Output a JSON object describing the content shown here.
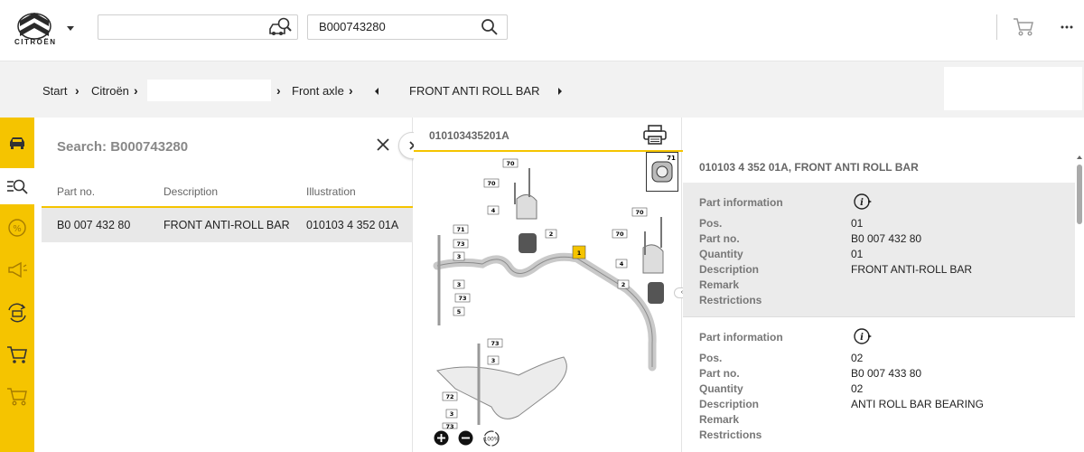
{
  "header": {
    "logo_word": "CITROËN",
    "part_search_value": "B000743280"
  },
  "breadcrumb": {
    "items": [
      "Start",
      "Citroën",
      "Front axle",
      "FRONT ANTI ROLL BAR"
    ]
  },
  "search_panel": {
    "title": "Search: B000743280",
    "columns": [
      "Part no.",
      "Description",
      "Illustration"
    ],
    "rows": [
      {
        "part_no": "B0 007 432 80",
        "description": "FRONT ANTI-ROLL BAR",
        "illustration": "010103 4 352 01A"
      }
    ]
  },
  "illustration": {
    "id": "010103435201A",
    "zoom_label": "100%",
    "thumb_label": "71",
    "callouts": [
      "70",
      "70",
      "4",
      "2",
      "1",
      "71",
      "73",
      "3",
      "3",
      "73",
      "5",
      "73",
      "3",
      "72",
      "3",
      "73",
      "70",
      "70",
      "4",
      "2",
      "71"
    ]
  },
  "detail": {
    "title": "010103 4 352 01A, FRONT ANTI ROLL BAR",
    "labels": {
      "section": "Part information",
      "pos": "Pos.",
      "part_no": "Part no.",
      "quantity": "Quantity",
      "description": "Description",
      "remark": "Remark",
      "restrictions": "Restrictions"
    },
    "blocks": [
      {
        "pos": "01",
        "part_no": "B0 007 432 80",
        "quantity": "01",
        "description": "FRONT ANTI-ROLL BAR"
      },
      {
        "pos": "02",
        "part_no": "B0 007 433 80",
        "quantity": "02",
        "description": "ANTI ROLL BAR BEARING"
      }
    ]
  },
  "colors": {
    "accent": "#f5c400",
    "row_highlight": "#e8e8e8",
    "callout_highlight": "#f5c400"
  },
  "icons": [
    "citroen-logo-icon",
    "chevron-down-icon",
    "vehicle-search-icon",
    "search-icon",
    "cart-icon",
    "more-icon",
    "car-icon",
    "search-list-icon",
    "percent-icon",
    "megaphone-icon",
    "exchange-icon",
    "cart-add-icon",
    "cart-disabled-icon",
    "close-icon",
    "chevron-right-icon",
    "print-icon",
    "zoom-in-icon",
    "zoom-out-icon",
    "zoom-reset-icon",
    "info-arrow-icon"
  ]
}
